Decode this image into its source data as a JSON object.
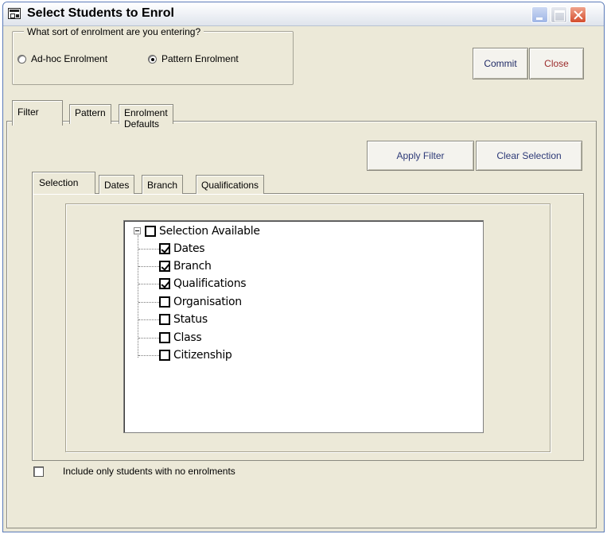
{
  "window": {
    "title": "Select Students to Enrol"
  },
  "enrolment_type": {
    "legend": "What sort of enrolment are you entering?",
    "options": [
      {
        "label": "Ad-hoc Enrolment",
        "selected": false
      },
      {
        "label": "Pattern Enrolment",
        "selected": true
      }
    ]
  },
  "actions": {
    "commit": "Commit",
    "close": "Close"
  },
  "main_tabs": [
    "Filter",
    "Pattern",
    "Enrolment Defaults"
  ],
  "active_main_tab": "Filter",
  "filter": {
    "apply_label": "Apply Filter",
    "clear_label": "Clear Selection",
    "sub_tabs": [
      "Selection",
      "Dates",
      "Branch",
      "Qualifications"
    ],
    "active_sub_tab": "Selection",
    "tree": {
      "root": {
        "label": "Selection Available",
        "checked": false,
        "expanded": true
      },
      "children": [
        {
          "label": "Dates",
          "checked": true
        },
        {
          "label": "Branch",
          "checked": true
        },
        {
          "label": "Qualifications",
          "checked": true
        },
        {
          "label": "Organisation",
          "checked": false
        },
        {
          "label": "Status",
          "checked": false
        },
        {
          "label": "Class",
          "checked": false
        },
        {
          "label": "Citizenship",
          "checked": false
        }
      ]
    },
    "no_enrolments_label": "Include only students with no enrolments",
    "no_enrolments_checked": false
  }
}
